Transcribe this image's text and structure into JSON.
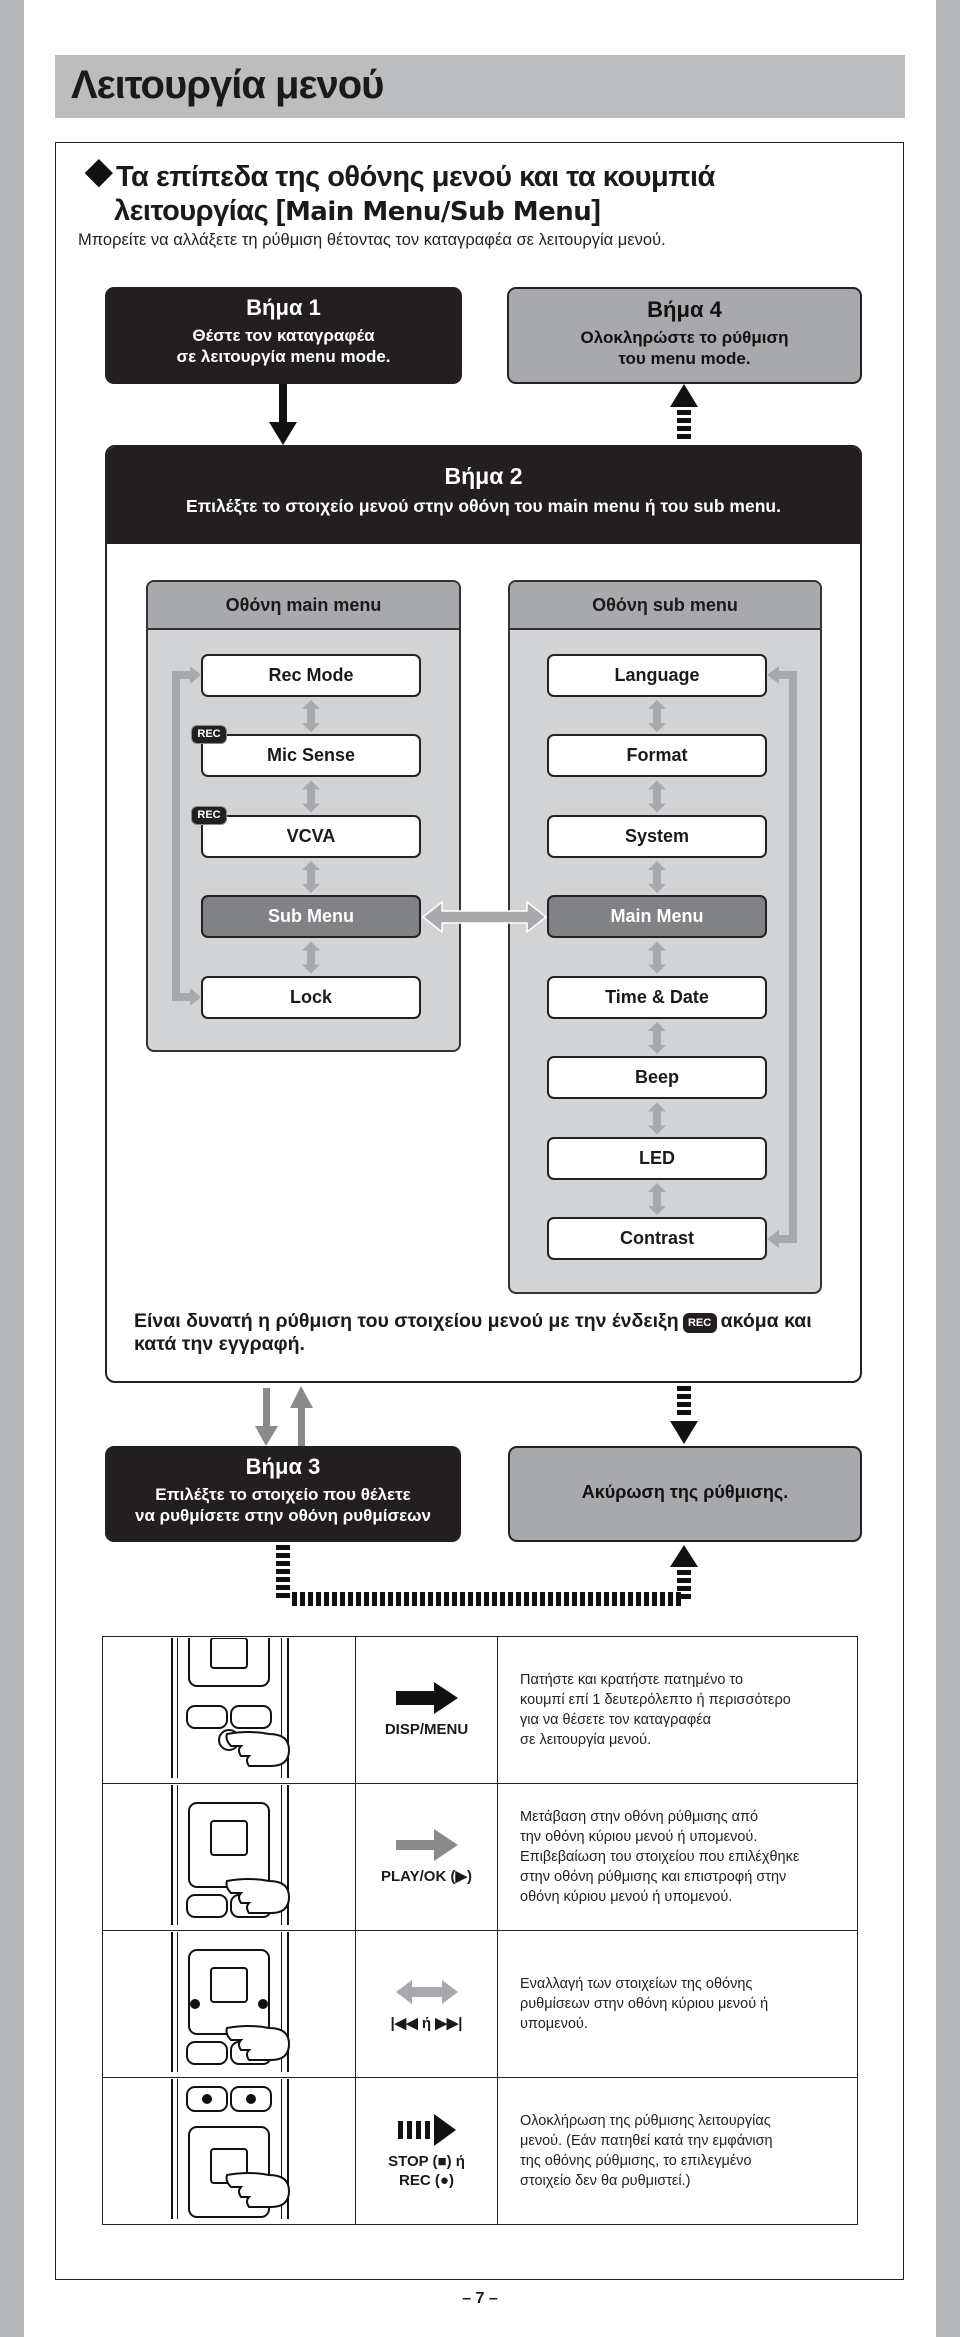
{
  "title": "Λειτουργία μενού",
  "heading": {
    "line1": "Τα επίπεδα της οθόνης μενού και τα κουμπιά",
    "line2_prefix": "λειτουργίας [",
    "line2_highlight": "Main Menu/Sub Menu",
    "line2_suffix": "]"
  },
  "subtitle": "Μπορείτε να αλλάξετε τη ρύθμιση θέτοντας τον καταγραφέα σε λειτουργία μενού.",
  "steps": {
    "step1": {
      "label": "Βήμα 1",
      "text": "Θέστε τον καταγραφέα\nσε λειτουργία menu mode."
    },
    "step2": {
      "label": "Βήμα 2",
      "text": "Επιλέξτε το στοιχείο μενού στην οθόνη του main menu ή του sub menu."
    },
    "step3": {
      "label": "Βήμα 3",
      "text": "Επιλέξτε το στοιχείο που θέλετε\nνα ρυθμίσετε στην οθόνη ρυθμίσεων"
    },
    "step4": {
      "label": "Βήμα 4",
      "text": "Ολοκληρώστε το ρύθμιση\nτου menu mode."
    },
    "cancel": {
      "text": "Ακύρωση της ρύθμισης."
    }
  },
  "main_menu": {
    "title": "Οθόνη main menu",
    "items": [
      "Rec Mode",
      "Mic Sense",
      "VCVA",
      "Sub Menu",
      "Lock"
    ]
  },
  "sub_menu": {
    "title": "Οθόνη sub menu",
    "items": [
      "Language",
      "Format",
      "System",
      "Main Menu",
      "Time & Date",
      "Beep",
      "LED",
      "Contrast"
    ]
  },
  "rec_badge": "REC",
  "note": {
    "before": "Είναι δυνατή η ρύθμιση του στοιχείου μενού με την ένδειξη",
    "after": "ακόμα και κατά την εγγραφή."
  },
  "operations": [
    {
      "button": "DISP/MENU",
      "icon": "black-arrow-right",
      "description": "Πατήστε και κρατήστε πατημένο το\nκουμπί επί 1 δευτερόλεπτο ή περισσότερο\nγια να θέσετε τον καταγραφέα\nσε λειτουργία μενού."
    },
    {
      "button": "PLAY/OK (▶)",
      "icon": "grey-arrow-right",
      "description": "Μετάβαση στην οθόνη ρύθμισης από\nτην οθόνη κύριου μενού ή υπομενού.\nΕπιβεβαίωση του στοιχείου που επιλέχθηκε\nστην οθόνη ρύθμισης και επιστροφή στην\nοθόνη κύριου μενού ή υπομενού."
    },
    {
      "button": "|◀◀ ή ▶▶|",
      "icon": "grey-double-arrow",
      "description": "Εναλλαγή των στοιχείων της οθόνης\nρυθμίσεων στην οθόνη κύριου μενού ή\nυπομενού."
    },
    {
      "button": "STOP (■) ή\nREC (●)",
      "icon": "dashed-arrow-right",
      "description": "Ολοκλήρωση της ρύθμισης λειτουργίας\nμενού. (Εάν πατηθεί κατά την εμφάνιση\nτης οθόνης ρύθμισης, το επιλεγμένο\nστοιχείο δεν θα ρυθμιστεί.)"
    }
  ],
  "page_number": "– 7 –",
  "colors": {
    "dark": "#231f20",
    "grey_box": "#a7a9ac",
    "panel": "#d1d3d4",
    "arrow_grey": "#a0a0a0",
    "selected": "#808285"
  }
}
